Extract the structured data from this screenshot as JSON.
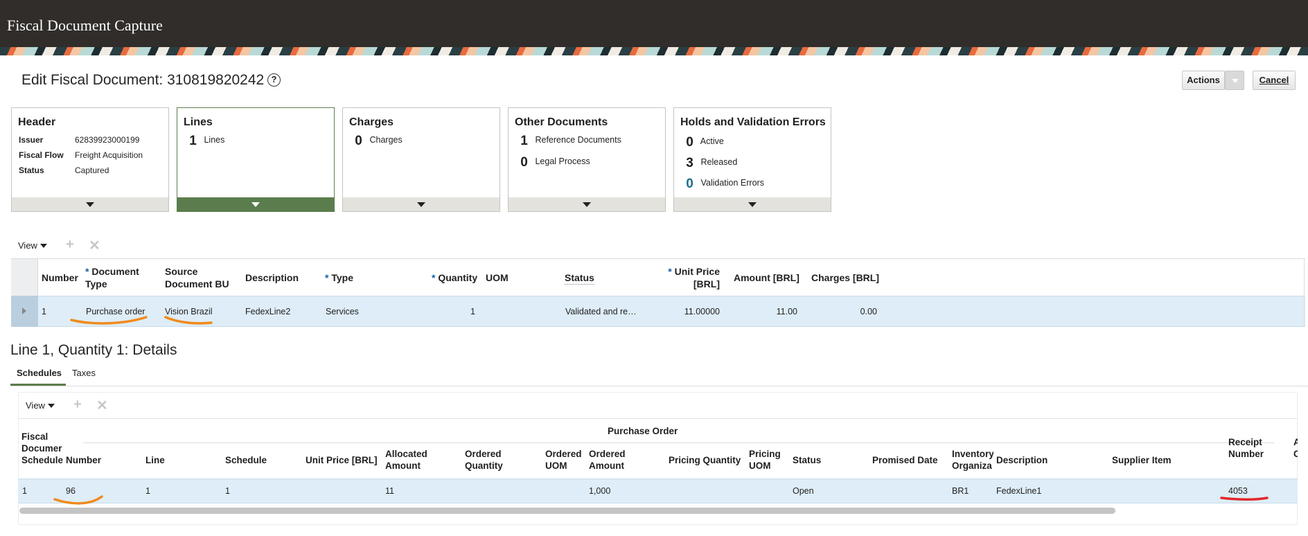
{
  "app": {
    "title": "Fiscal Document Capture"
  },
  "page": {
    "title": "Edit Fiscal Document: 310819820242"
  },
  "buttons": {
    "actions": "Actions",
    "cancel": "Cancel"
  },
  "tiles": {
    "header": {
      "title": "Header",
      "fields": [
        {
          "label": "Issuer",
          "value": "62839923000199"
        },
        {
          "label": "Fiscal Flow",
          "value": "Freight Acquisition"
        },
        {
          "label": "Status",
          "value": "Captured"
        }
      ]
    },
    "lines": {
      "title": "Lines",
      "count": "1",
      "label": "Lines"
    },
    "charges": {
      "title": "Charges",
      "count": "0",
      "label": "Charges"
    },
    "other_documents": {
      "title": "Other Documents",
      "items": [
        {
          "count": "1",
          "label": "Reference Documents"
        },
        {
          "count": "0",
          "label": "Legal Process"
        }
      ]
    },
    "holds": {
      "title": "Holds and Validation Errors",
      "items": [
        {
          "count": "0",
          "label": "Active"
        },
        {
          "count": "3",
          "label": "Released"
        },
        {
          "count": "0",
          "label": "Validation Errors"
        }
      ]
    }
  },
  "lines_table": {
    "view_label": "View",
    "headers": {
      "number": "Number",
      "document_type_1": "Document",
      "document_type_2": "Type",
      "source_bu_1": "Source",
      "source_bu_2": "Document BU",
      "description": "Description",
      "type": "Type",
      "quantity": "Quantity",
      "uom": "UOM",
      "status": "Status",
      "unit_price_1": "Unit Price",
      "unit_price_2": "[BRL]",
      "amount": "Amount [BRL]",
      "charges": "Charges [BRL]"
    },
    "row": {
      "number": "1",
      "document_type": "Purchase order",
      "source_bu": "Vision Brazil",
      "description": "FedexLine2",
      "type": "Services",
      "quantity": "1",
      "uom": "",
      "status": "Validated and re…",
      "unit_price": "11.00000",
      "amount": "11.00",
      "charges": "0.00"
    }
  },
  "details": {
    "title": "Line 1, Quantity 1: Details",
    "tabs": [
      "Schedules",
      "Taxes"
    ],
    "view_label": "View",
    "group_header": "Purchase Order",
    "headers": {
      "fiscal_1": "Fiscal",
      "fiscal_2": "Documer",
      "fiscal_3": "Schedule",
      "number": "Number",
      "line": "Line",
      "schedule": "Schedule",
      "unit_price": "Unit Price [BRL]",
      "allocated_1": "Allocated",
      "allocated_2": "Amount",
      "ordered_qty_1": "Ordered",
      "ordered_qty_2": "Quantity",
      "ordered_uom_1": "Ordered",
      "ordered_uom_2": "UOM",
      "ordered_amount_1": "Ordered",
      "ordered_amount_2": "Amount",
      "pricing_qty": "Pricing Quantity",
      "pricing_uom_1": "Pricing",
      "pricing_uom_2": "UOM",
      "status": "Status",
      "promised_date": "Promised Date",
      "inventory_1": "Inventory",
      "inventory_2": "Organiza",
      "description": "Description",
      "supplier_item": "Supplier Item",
      "receipt_1": "Receipt",
      "receipt_2": "Number",
      "cut_1": "A",
      "cut_2": "C"
    },
    "row": {
      "fiscal_schedule": "1",
      "number": "96",
      "line": "1",
      "schedule": "1",
      "allocated_amount": "11",
      "ordered_amount": "1,000",
      "status": "Open",
      "inventory_org": "BR1",
      "description": "FedexLine1",
      "receipt_number": "4053"
    }
  },
  "colors": {
    "accent_green": "#5b7d4d",
    "header_bg": "#312d2a",
    "selected_row": "#deedf7",
    "annotation_orange": "#f08a1c",
    "annotation_red": "#e3262b"
  }
}
